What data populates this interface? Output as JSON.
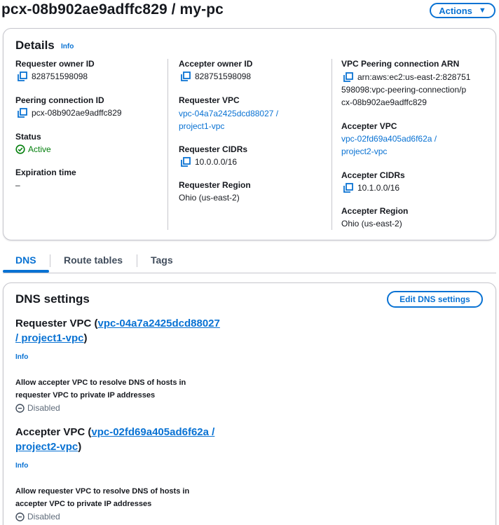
{
  "page": {
    "title": "pcx-08b902ae9adffc829 / my-pc",
    "actions_label": "Actions"
  },
  "details": {
    "heading": "Details",
    "info": "Info",
    "col1": {
      "requester_owner_id_label": "Requester owner ID",
      "requester_owner_id": "828751598098",
      "peering_connection_id_label": "Peering connection ID",
      "peering_connection_id": "pcx-08b902ae9adffc829",
      "status_label": "Status",
      "status": "Active",
      "expiration_label": "Expiration time",
      "expiration": "–"
    },
    "col2": {
      "accepter_owner_id_label": "Accepter owner ID",
      "accepter_owner_id": "828751598098",
      "requester_vpc_label": "Requester VPC",
      "requester_vpc_line1": "vpc-04a7a2425dcd88027 /",
      "requester_vpc_line2": "project1-vpc",
      "requester_cidrs_label": "Requester CIDRs",
      "requester_cidrs": "10.0.0.0/16",
      "requester_region_label": "Requester Region",
      "requester_region": "Ohio (us-east-2)"
    },
    "col3": {
      "arn_label": "VPC Peering connection ARN",
      "arn_line1": "arn:aws:ec2:us-east-2:828751",
      "arn_line2": "598098:vpc-peering-connection/p",
      "arn_line3": "cx-08b902ae9adffc829",
      "accepter_vpc_label": "Accepter VPC",
      "accepter_vpc_line1": "vpc-02fd69a405ad6f62a /",
      "accepter_vpc_line2": "project2-vpc",
      "accepter_cidrs_label": "Accepter CIDRs",
      "accepter_cidrs": "10.1.0.0/16",
      "accepter_region_label": "Accepter Region",
      "accepter_region": "Ohio (us-east-2)"
    }
  },
  "tabs": [
    {
      "label": "DNS",
      "active": true
    },
    {
      "label": "Route tables",
      "active": false
    },
    {
      "label": "Tags",
      "active": false
    }
  ],
  "dns": {
    "heading": "DNS settings",
    "edit_label": "Edit DNS settings",
    "requester": {
      "prefix": "Requester VPC (",
      "link_line1": "vpc-04a7a2425dcd88027",
      "link_line2": "/ project1-vpc",
      "suffix": ")",
      "info": "Info",
      "setting_line1": "Allow accepter VPC to resolve DNS of hosts in",
      "setting_line2": "requester VPC to private IP addresses",
      "setting_value": "Disabled"
    },
    "accepter": {
      "prefix": "Accepter VPC (",
      "link_line1": "vpc-02fd69a405ad6f62a /",
      "link_line2": "project2-vpc",
      "suffix": ")",
      "info": "Info",
      "setting_line1": "Allow requester VPC to resolve DNS of hosts in",
      "setting_line2": "accepter VPC to private IP addresses",
      "setting_value": "Disabled"
    }
  },
  "colors": {
    "accent": "#0972d3",
    "success": "#037f0c",
    "muted": "#5f6b7a"
  },
  "icons": {
    "copy": "copy-icon",
    "status_ok": "check-circle-icon",
    "disabled": "minus-circle-icon",
    "caret": "caret-down-icon"
  }
}
